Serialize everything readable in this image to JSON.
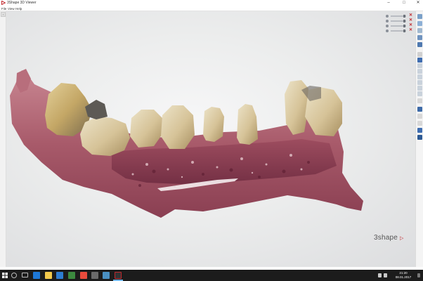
{
  "window": {
    "title": "3Shape 3D Viewer",
    "min_label": "–",
    "max_label": "□",
    "close_label": "✕"
  },
  "menu": {
    "items": [
      "File",
      "View",
      "Help"
    ]
  },
  "left_panel": {
    "tab_label": "‹"
  },
  "layers": {
    "rows": [
      {
        "level": 0.8
      },
      {
        "level": 0.8
      },
      {
        "level": 0.8
      },
      {
        "level": 0.8
      }
    ],
    "close_label": "✕"
  },
  "viewport": {
    "model": "dental-scan-lower-jaw"
  },
  "branding": {
    "text": "3shape",
    "mark": "▷"
  },
  "colors": {
    "accent": "#c1272d",
    "taskbar": "#1c1c1c",
    "gum": "#a85a6a",
    "tooth": "#d9c9a3"
  },
  "taskbar": {
    "icons": [
      "windows-start-icon",
      "search-icon",
      "task-view-icon",
      "edge-icon",
      "file-explorer-icon",
      "store-icon",
      "mail-icon",
      "chrome-icon",
      "app-icon",
      "app-icon",
      "app-icon",
      "3shape-viewer-icon"
    ],
    "time": "21:20",
    "date": "08.01.2017"
  }
}
